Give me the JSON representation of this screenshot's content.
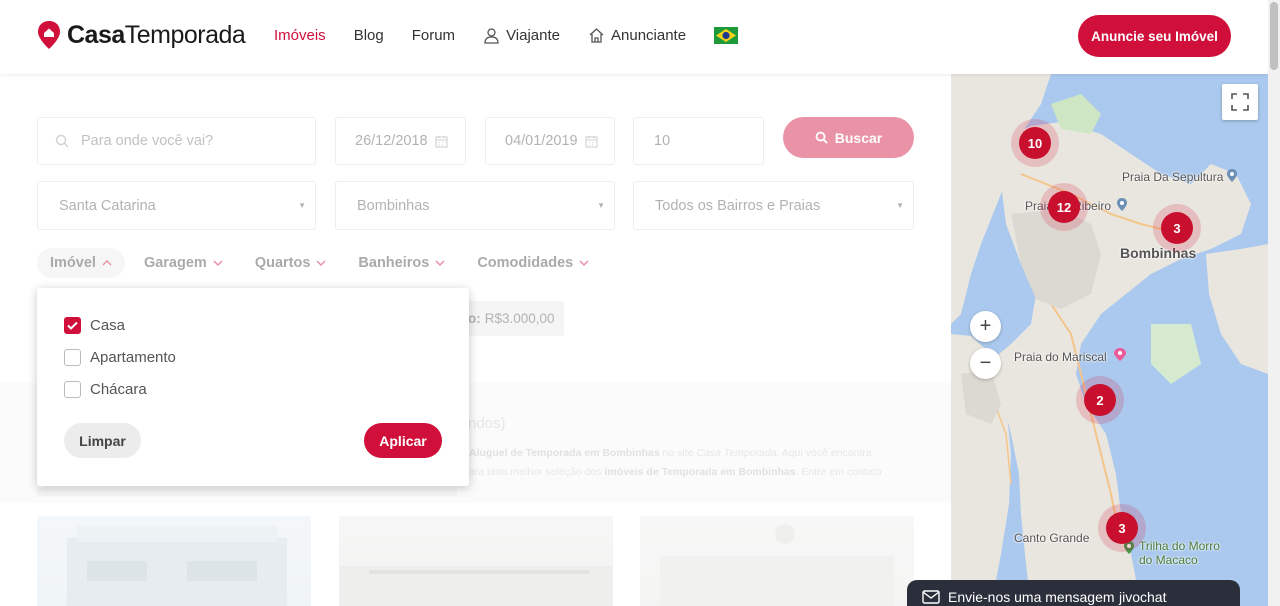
{
  "header": {
    "brand_bold": "Casa",
    "brand_rest": "Temporada",
    "nav": [
      {
        "label": "Imóveis"
      },
      {
        "label": "Blog"
      },
      {
        "label": "Forum"
      },
      {
        "label": "Viajante"
      },
      {
        "label": "Anunciante"
      }
    ],
    "cta_label": "Anuncie seu Imóvel"
  },
  "search": {
    "where_placeholder": "Para onde você vai?",
    "checkin": "26/12/2018",
    "checkout": "04/01/2019",
    "guests": "10",
    "button_label": "Buscar",
    "state": "Santa Catarina",
    "city": "Bombinhas",
    "neighborhood": "Todos os Bairros e Praias"
  },
  "filters": [
    "Imóvel",
    "Garagem",
    "Quartos",
    "Banheiros",
    "Comodidades"
  ],
  "dropdown": {
    "options": [
      {
        "label": "Casa",
        "checked": true
      },
      {
        "label": "Apartamento",
        "checked": false
      },
      {
        "label": "Chácara",
        "checked": false
      }
    ],
    "clear_label": "Limpar",
    "apply_label": "Aplicar"
  },
  "price_filter": {
    "prefix": "o:",
    "value": "R$3.000,00"
  },
  "results": {
    "heading_fragment": "ndos)",
    "desc_line1_a": "Aluguel de Temporada em Bombinhas",
    "desc_line1_b": " no site ",
    "desc_line1_c": "Casa Temporada",
    "desc_line1_d": ". Aqui você encontra",
    "desc_line2_a": "ara uma melhor seleção dos ",
    "desc_line2_b": "imóveis de Temporada em Bombinhas",
    "desc_line2_c": ". Entre em contato"
  },
  "map": {
    "labels": {
      "sepultura": "Praia Da Sepultura",
      "ribeiro": "Praia do Ribeiro",
      "bombinhas": "Bombinhas",
      "mariscal": "Praia do Mariscal",
      "canto_grande": "Canto Grande",
      "trilha_1": "Trilha do Morro",
      "trilha_2": "do Macaco"
    },
    "clusters": [
      "10",
      "12",
      "3",
      "2",
      "3"
    ],
    "zoom_in": "+",
    "zoom_out": "−"
  },
  "chat": {
    "message": "Envie-nos uma mensagem",
    "brand": "jivochat"
  },
  "colors": {
    "accent": "#d0103a",
    "water": "#abc9ee",
    "land": "#e8e6e0"
  }
}
